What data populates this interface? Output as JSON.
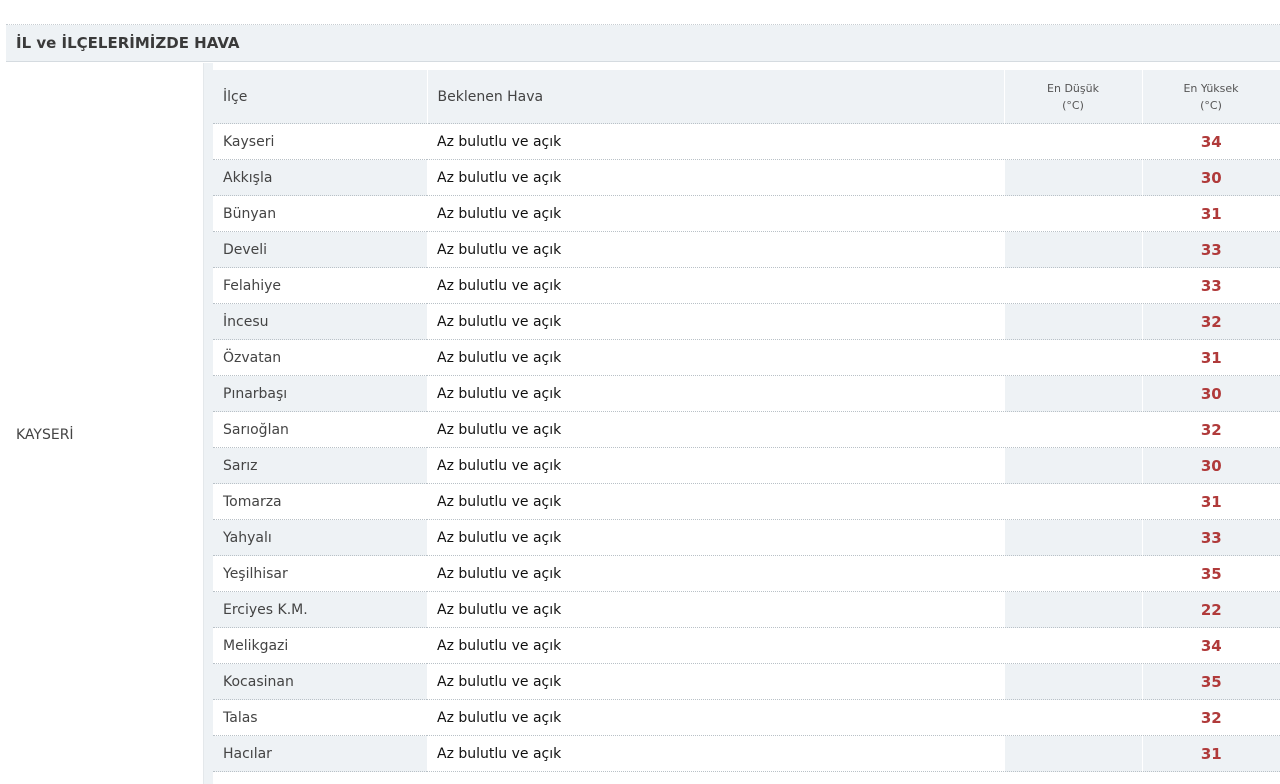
{
  "section": {
    "title": "İL ve İLÇELERİMİZDE HAVA"
  },
  "province": {
    "name": "KAYSERİ"
  },
  "table": {
    "headers": {
      "district": "İlçe",
      "expected_weather": "Beklenen Hava",
      "min_label": "En Düşük",
      "min_unit": "(°C)",
      "max_label": "En Yüksek",
      "max_unit": "(°C)"
    },
    "rows": [
      {
        "district": "Kayseri",
        "weather": "Az bulutlu ve açık",
        "min": "",
        "max": "34"
      },
      {
        "district": "Akkışla",
        "weather": "Az bulutlu ve açık",
        "min": "",
        "max": "30"
      },
      {
        "district": "Bünyan",
        "weather": "Az bulutlu ve açık",
        "min": "",
        "max": "31"
      },
      {
        "district": "Develi",
        "weather": "Az bulutlu ve açık",
        "min": "",
        "max": "33"
      },
      {
        "district": "Felahiye",
        "weather": "Az bulutlu ve açık",
        "min": "",
        "max": "33"
      },
      {
        "district": "İncesu",
        "weather": "Az bulutlu ve açık",
        "min": "",
        "max": "32"
      },
      {
        "district": "Özvatan",
        "weather": "Az bulutlu ve açık",
        "min": "",
        "max": "31"
      },
      {
        "district": "Pınarbaşı",
        "weather": "Az bulutlu ve açık",
        "min": "",
        "max": "30"
      },
      {
        "district": "Sarıoğlan",
        "weather": "Az bulutlu ve açık",
        "min": "",
        "max": "32"
      },
      {
        "district": "Sarız",
        "weather": "Az bulutlu ve açık",
        "min": "",
        "max": "30"
      },
      {
        "district": "Tomarza",
        "weather": "Az bulutlu ve açık",
        "min": "",
        "max": "31"
      },
      {
        "district": "Yahyalı",
        "weather": "Az bulutlu ve açık",
        "min": "",
        "max": "33"
      },
      {
        "district": "Yeşilhisar",
        "weather": "Az bulutlu ve açık",
        "min": "",
        "max": "35"
      },
      {
        "district": "Erciyes K.M.",
        "weather": "Az bulutlu ve açık",
        "min": "",
        "max": "22"
      },
      {
        "district": "Melikgazi",
        "weather": "Az bulutlu ve açık",
        "min": "",
        "max": "34"
      },
      {
        "district": "Kocasinan",
        "weather": "Az bulutlu ve açık",
        "min": "",
        "max": "35"
      },
      {
        "district": "Talas",
        "weather": "Az bulutlu ve açık",
        "min": "",
        "max": "32"
      },
      {
        "district": "Hacılar",
        "weather": "Az bulutlu ve açık",
        "min": "",
        "max": "31"
      }
    ]
  },
  "colors": {
    "header_bg": "#eef2f5",
    "max_temp": "#b03a3a"
  }
}
